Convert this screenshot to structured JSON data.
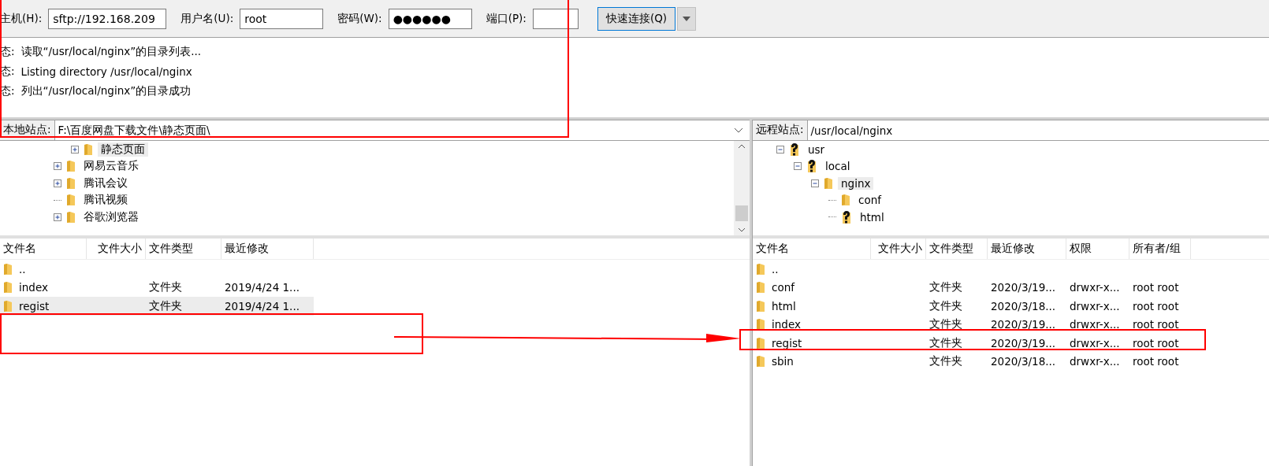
{
  "toolbar": {
    "host_label": "主机(H):",
    "host_value": "sftp://192.168.209",
    "user_label": "用户名(U):",
    "user_value": "root",
    "password_label": "密码(W):",
    "password_value": "●●●●●●",
    "port_label": "端口(P):",
    "connect_button": "快速连接(Q)"
  },
  "log": [
    {
      "label": "态:",
      "message": "读取“/usr/local/nginx”的目录列表..."
    },
    {
      "label": "态:",
      "message": "Listing directory /usr/local/nginx"
    },
    {
      "label": "态:",
      "message": "列出“/usr/local/nginx”的目录成功"
    }
  ],
  "local": {
    "site_label": "本地站点:",
    "path": "F:\\百度网盘下载文件\\静态页面\\",
    "tree": [
      {
        "name": "静态页面",
        "kind": "folder",
        "expandable": true,
        "expanded": false,
        "selected": true
      },
      {
        "name": "网易云音乐",
        "kind": "folder",
        "expandable": true,
        "expanded": false,
        "selected": false
      },
      {
        "name": "腾讯会议",
        "kind": "folder",
        "expandable": true,
        "expanded": false,
        "selected": false
      },
      {
        "name": "腾讯视频",
        "kind": "folder",
        "expandable": false,
        "selected": false
      },
      {
        "name": "谷歌浏览器",
        "kind": "folder",
        "expandable": true,
        "expanded": false,
        "selected": false
      }
    ],
    "columns": [
      "文件名",
      "文件大小",
      "文件类型",
      "最近修改"
    ],
    "rows": [
      {
        "cells": [
          "..",
          "",
          "",
          ""
        ],
        "selected": false
      },
      {
        "cells": [
          "index",
          "",
          "文件夹",
          "2019/4/24 1..."
        ],
        "selected": false
      },
      {
        "cells": [
          "regist",
          "",
          "文件夹",
          "2019/4/24 1..."
        ],
        "selected": true
      }
    ]
  },
  "remote": {
    "site_label": "远程站点:",
    "path": "/usr/local/nginx",
    "tree": [
      {
        "name": "usr",
        "kind": "unknown",
        "expandable": true,
        "expanded": true,
        "selected": false,
        "children": [
          {
            "name": "local",
            "kind": "unknown",
            "expandable": true,
            "expanded": true,
            "selected": false,
            "children": [
              {
                "name": "nginx",
                "kind": "folder",
                "expandable": true,
                "expanded": true,
                "selected": true,
                "children": [
                  {
                    "name": "conf",
                    "kind": "folder",
                    "expandable": false,
                    "selected": false
                  },
                  {
                    "name": "html",
                    "kind": "unknown",
                    "expandable": false,
                    "selected": false
                  }
                ]
              }
            ]
          }
        ]
      }
    ],
    "columns": [
      "文件名",
      "文件大小",
      "文件类型",
      "最近修改",
      "权限",
      "所有者/组"
    ],
    "rows": [
      {
        "cells": [
          "..",
          "",
          "",
          "",
          "",
          ""
        ],
        "selected": false
      },
      {
        "cells": [
          "conf",
          "",
          "文件夹",
          "2020/3/19...",
          "drwxr-x...",
          "root root"
        ],
        "selected": false
      },
      {
        "cells": [
          "html",
          "",
          "文件夹",
          "2020/3/18...",
          "drwxr-x...",
          "root root"
        ],
        "selected": false
      },
      {
        "cells": [
          "index",
          "",
          "文件夹",
          "2020/3/19...",
          "drwxr-x...",
          "root root"
        ],
        "selected": false
      },
      {
        "cells": [
          "regist",
          "",
          "文件夹",
          "2020/3/19...",
          "drwxr-x...",
          "root root"
        ],
        "selected": false
      },
      {
        "cells": [
          "sbin",
          "",
          "文件夹",
          "2020/3/18...",
          "drwxr-x...",
          "root root"
        ],
        "selected": false
      }
    ]
  }
}
